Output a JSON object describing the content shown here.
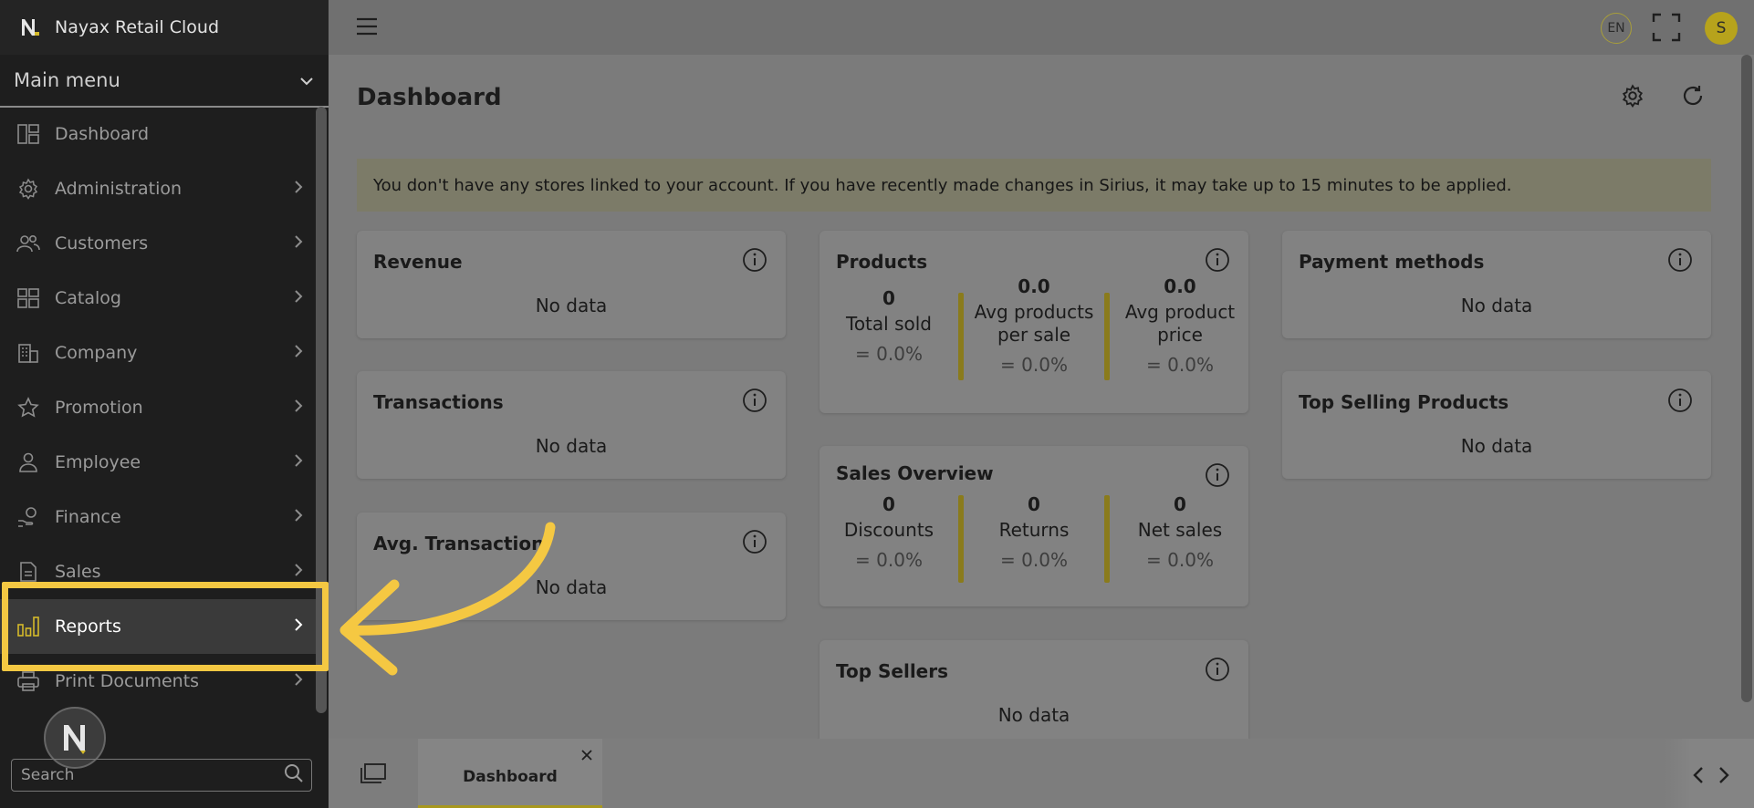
{
  "app": {
    "title": "Nayax Retail Cloud"
  },
  "sidebar": {
    "main_menu_label": "Main menu",
    "items": [
      {
        "label": "Dashboard",
        "icon": "dashboard-icon",
        "has_children": false
      },
      {
        "label": "Administration",
        "icon": "gear-icon",
        "has_children": true
      },
      {
        "label": "Customers",
        "icon": "users-icon",
        "has_children": true
      },
      {
        "label": "Catalog",
        "icon": "grid-icon",
        "has_children": true
      },
      {
        "label": "Company",
        "icon": "building-icon",
        "has_children": true
      },
      {
        "label": "Promotion",
        "icon": "star-icon",
        "has_children": true
      },
      {
        "label": "Employee",
        "icon": "person-icon",
        "has_children": true
      },
      {
        "label": "Finance",
        "icon": "hand-coin-icon",
        "has_children": true
      },
      {
        "label": "Sales",
        "icon": "document-icon",
        "has_children": true
      },
      {
        "label": "Reports",
        "icon": "bar-chart-icon",
        "has_children": true,
        "active": true
      },
      {
        "label": "Print Documents",
        "icon": "printer-icon",
        "has_children": true
      }
    ],
    "search_placeholder": "Search"
  },
  "header": {
    "language": "EN",
    "avatar_initial": "S"
  },
  "dashboard": {
    "title": "Dashboard",
    "notice": "You don't have any stores linked to your account. If you have recently made changes in Sirius, it may take up to 15 minutes to be applied.",
    "no_data": "No data",
    "cards": {
      "revenue": {
        "title": "Revenue"
      },
      "transactions": {
        "title": "Transactions"
      },
      "avg_transaction": {
        "title": "Avg. Transaction"
      },
      "payment_methods": {
        "title": "Payment methods"
      },
      "top_selling_products": {
        "title": "Top Selling Products"
      },
      "top_sellers": {
        "title": "Top Sellers"
      },
      "products": {
        "title": "Products",
        "stats": [
          {
            "value": "0",
            "label": "Total sold",
            "change": "0.0%"
          },
          {
            "value": "0.0",
            "label": "Avg products per sale",
            "change": "0.0%"
          },
          {
            "value": "0.0",
            "label": "Avg product price",
            "change": "0.0%"
          }
        ]
      },
      "sales_overview": {
        "title": "Sales Overview",
        "stats": [
          {
            "value": "0",
            "label": "Discounts",
            "change": "0.0%"
          },
          {
            "value": "0",
            "label": "Returns",
            "change": "0.0%"
          },
          {
            "value": "0",
            "label": "Net sales",
            "change": "0.0%"
          }
        ]
      }
    }
  },
  "tabs": [
    {
      "label": "Dashboard"
    }
  ],
  "colors": {
    "highlight": "#f5c842",
    "accent": "#b7a31c"
  }
}
